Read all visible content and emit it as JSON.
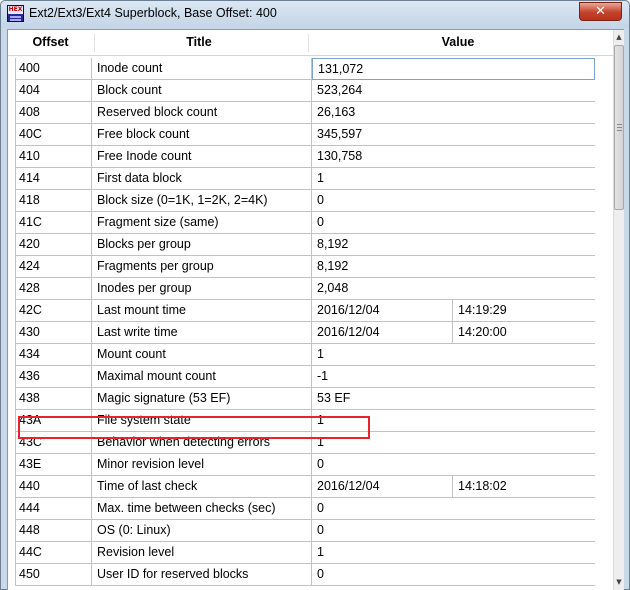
{
  "window": {
    "title": "Ext2/Ext3/Ext4 Superblock, Base Offset: 400",
    "app_icon_label": "HEX",
    "close_symbol": "✕"
  },
  "columns": {
    "offset": "Offset",
    "title": "Title",
    "value": "Value"
  },
  "rows": [
    {
      "offset": "400",
      "title": "Inode count",
      "value": "131,072"
    },
    {
      "offset": "404",
      "title": "Block count",
      "value": "523,264"
    },
    {
      "offset": "408",
      "title": "Reserved block count",
      "value": "26,163"
    },
    {
      "offset": "40C",
      "title": "Free block count",
      "value": "345,597"
    },
    {
      "offset": "410",
      "title": "Free Inode count",
      "value": "130,758"
    },
    {
      "offset": "414",
      "title": "First data block",
      "value": "1"
    },
    {
      "offset": "418",
      "title": "Block size (0=1K, 1=2K, 2=4K)",
      "value": "0"
    },
    {
      "offset": "41C",
      "title": "Fragment size (same)",
      "value": "0"
    },
    {
      "offset": "420",
      "title": "Blocks per group",
      "value": "8,192"
    },
    {
      "offset": "424",
      "title": "Fragments per group",
      "value": "8,192"
    },
    {
      "offset": "428",
      "title": "Inodes per group",
      "value": "2,048"
    },
    {
      "offset": "42C",
      "title": "Last mount time",
      "value": "2016/12/04",
      "value2": "14:19:29"
    },
    {
      "offset": "430",
      "title": "Last write time",
      "value": "2016/12/04",
      "value2": "14:20:00"
    },
    {
      "offset": "434",
      "title": "Mount count",
      "value": "1"
    },
    {
      "offset": "436",
      "title": "Maximal mount count",
      "value": "-1"
    },
    {
      "offset": "438",
      "title": "Magic signature (53 EF)",
      "value": "53 EF"
    },
    {
      "offset": "43A",
      "title": "File system state",
      "value": "1"
    },
    {
      "offset": "43C",
      "title": "Behavior when detecting errors",
      "value": "1"
    },
    {
      "offset": "43E",
      "title": "Minor revision level",
      "value": "0"
    },
    {
      "offset": "440",
      "title": "Time of last check",
      "value": "2016/12/04",
      "value2": "14:18:02"
    },
    {
      "offset": "444",
      "title": "Max. time between checks (sec)",
      "value": "0"
    },
    {
      "offset": "448",
      "title": "OS (0: Linux)",
      "value": "0"
    },
    {
      "offset": "44C",
      "title": "Revision level",
      "value": "1"
    },
    {
      "offset": "450",
      "title": "User ID for reserved blocks",
      "value": "0"
    }
  ],
  "highlighted_row_offset": "438",
  "colors": {
    "highlight_border": "#e8232e",
    "close_button": "#c4422b",
    "titlebar": "#c3d5e8"
  },
  "scrollbar": {
    "up_arrow": "▲",
    "down_arrow": "▼"
  }
}
